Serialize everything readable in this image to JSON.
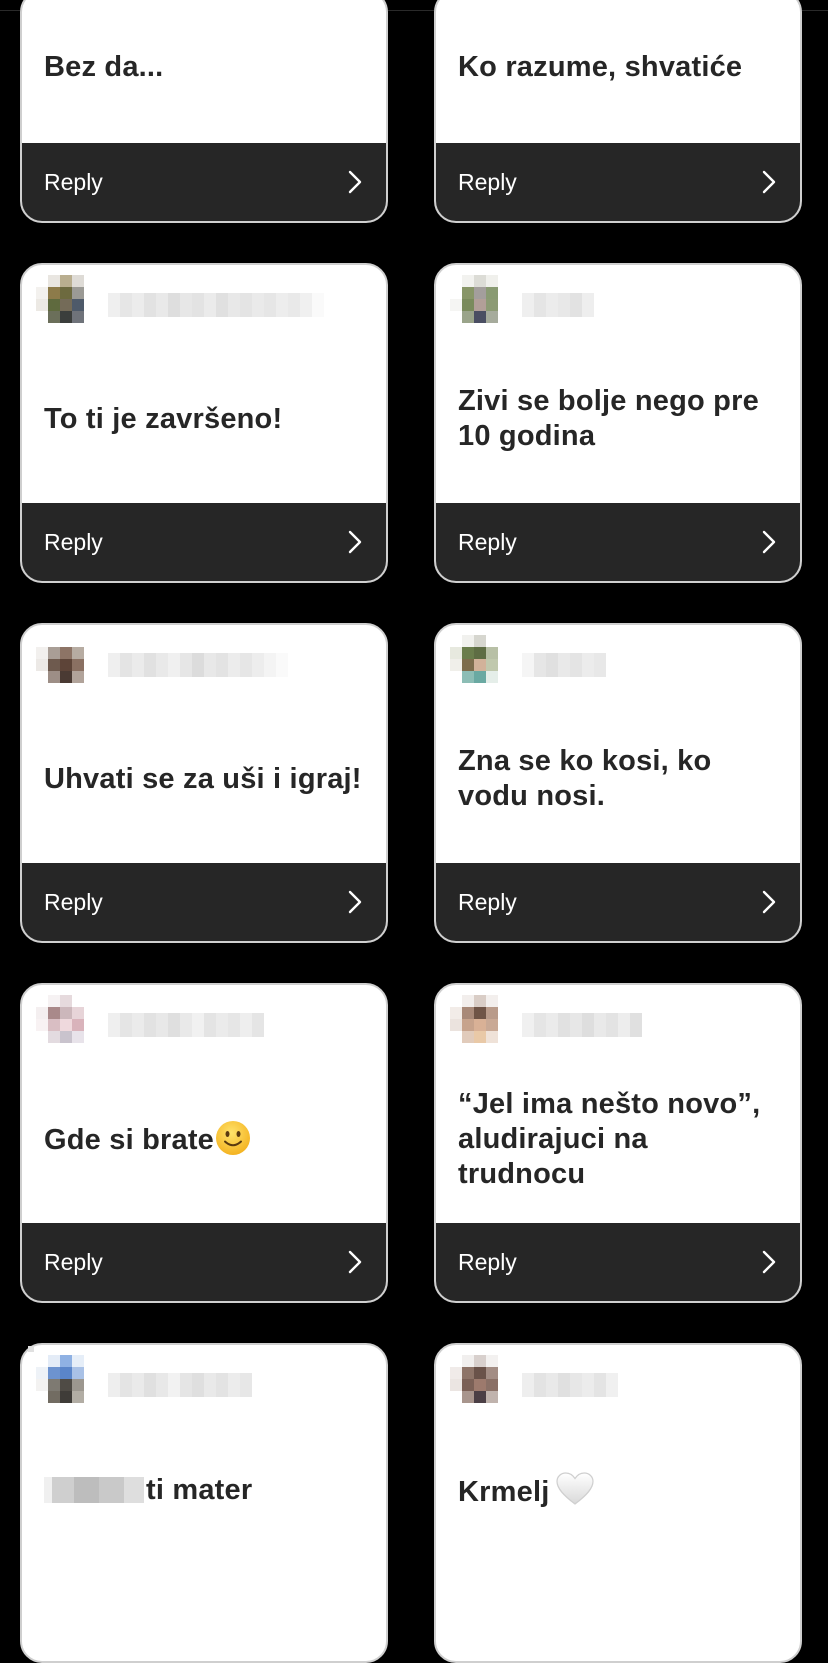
{
  "reply_label": "Reply",
  "cards": [
    {
      "id": "c1",
      "message": "Bez da...",
      "has_header": false
    },
    {
      "id": "c2",
      "message": "Ko razume, shvatiće",
      "has_header": false
    },
    {
      "id": "c3",
      "message": "To ti je završeno!",
      "has_header": true
    },
    {
      "id": "c4",
      "message": "Zivi se bolje nego pre 10 godina",
      "has_header": true
    },
    {
      "id": "c5",
      "message": "Uhvati se za uši i igraj!",
      "has_header": true
    },
    {
      "id": "c6",
      "message": "Zna se ko kosi, ko vodu nosi.",
      "has_header": true
    },
    {
      "id": "c7",
      "message": "Gde si brate",
      "has_header": true,
      "emoji": "slightly-smiling-face-icon"
    },
    {
      "id": "c8",
      "message": "“Jel ima nešto novo”, aludirajuci na trudnocu",
      "has_header": true
    },
    {
      "id": "c9",
      "message": "ti mater",
      "has_header": true,
      "redacted_prefix": true
    },
    {
      "id": "c10",
      "message": "Krmelj",
      "has_header": true,
      "emoji": "white-heart-icon"
    }
  ],
  "colors": {
    "background": "#000000",
    "card": "#ffffff",
    "reply_bar": "#262626",
    "text": "#262626"
  }
}
